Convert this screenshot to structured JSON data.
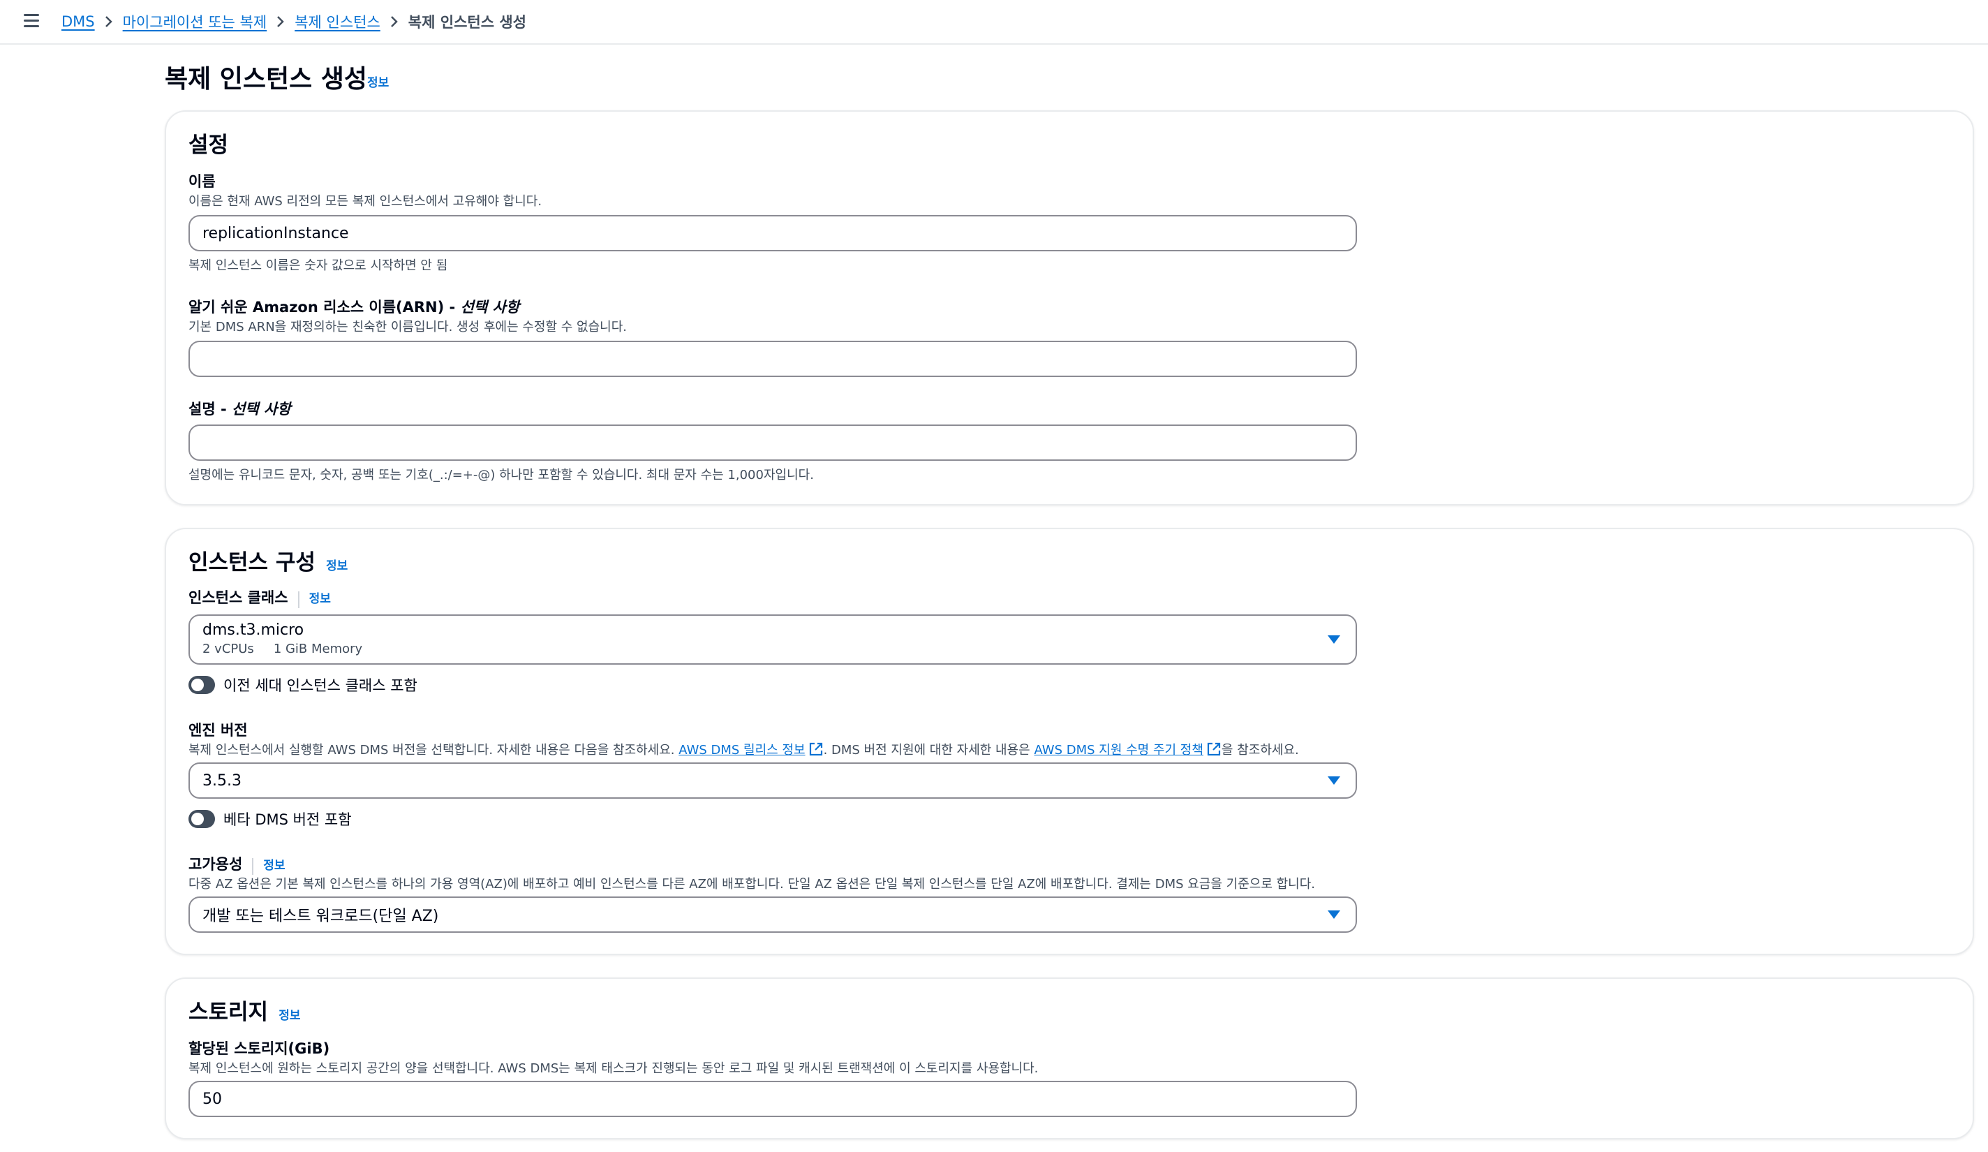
{
  "breadcrumb": {
    "items": [
      "DMS",
      "마이그레이션 또는 복제",
      "복제 인스턴스"
    ],
    "current": "복제 인스턴스 생성"
  },
  "page": {
    "title": "복제 인스턴스 생성",
    "info": "정보"
  },
  "settings": {
    "title": "설정",
    "name": {
      "label": "이름",
      "description": "이름은 현재 AWS 리전의 모든 복제 인스턴스에서 고유해야 합니다.",
      "value": "replicationInstance",
      "constraint": "복제 인스턴스 이름은 숫자 값으로 시작하면 안 됨"
    },
    "arn": {
      "label": "알기 쉬운 Amazon 리소스 이름(ARN) - ",
      "optional": "선택 사항",
      "description": "기본 DMS ARN을 재정의하는 친숙한 이름입니다. 생성 후에는 수정할 수 없습니다.",
      "value": ""
    },
    "description": {
      "label": "설명 - ",
      "optional": "선택 사항",
      "value": "",
      "constraint": "설명에는 유니코드 문자, 숫자, 공백 또는 기호(_.:/=+-@) 하나만 포함할 수 있습니다. 최대 문자 수는 1,000자입니다."
    }
  },
  "instance_config": {
    "title": "인스턴스 구성",
    "info": "정보",
    "instance_class": {
      "label": "인스턴스 클래스",
      "info": "정보",
      "value": "dms.t3.micro",
      "vcpus": "2 vCPUs",
      "memory": "1 GiB Memory"
    },
    "previous_gen_toggle": "이전 세대 인스턴스 클래스 포함",
    "engine": {
      "label": "엔진 버전",
      "desc_part1": "복제 인스턴스에서 실행할 AWS DMS 버전을 선택합니다. 자세한 내용은 다음을 참조하세요. ",
      "link1": "AWS DMS 릴리스 정보",
      "desc_part2": ". DMS 버전 지원에 대한 자세한 내용은 ",
      "link2": "AWS DMS 지원 수명 주기 정책",
      "desc_part3": "을 참조하세요.",
      "value": "3.5.3"
    },
    "beta_toggle": "베타 DMS 버전 포함",
    "ha": {
      "label": "고가용성",
      "info": "정보",
      "description": "다중 AZ 옵션은 기본 복제 인스턴스를 하나의 가용 영역(AZ)에 배포하고 예비 인스턴스를 다른 AZ에 배포합니다. 단일 AZ 옵션은 단일 복제 인스턴스를 단일 AZ에 배포합니다. 결제는 DMS 요금을 기준으로 합니다.",
      "value": "개발 또는 테스트 워크로드(단일 AZ)"
    }
  },
  "storage": {
    "title": "스토리지",
    "info": "정보",
    "allocated": {
      "label": "할당된 스토리지(GiB)",
      "description": "복제 인스턴스에 원하는 스토리지 공간의 양을 선택합니다. AWS DMS는 복제 태스크가 진행되는 동안 로그 파일 및 캐시된 트랜잭션에 이 스토리지를 사용합니다.",
      "value": "50"
    }
  },
  "colors": {
    "link": "#0972d3",
    "text": "#000716",
    "muted": "#414d5c",
    "border": "#8c8c94"
  }
}
